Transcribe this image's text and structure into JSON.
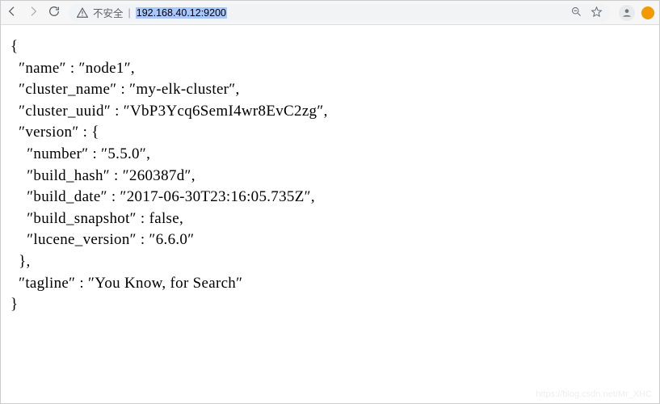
{
  "toolbar": {
    "insecure_label": "不安全",
    "url": "192.168.40.12:9200"
  },
  "response": {
    "name": "node1",
    "cluster_name": "my-elk-cluster",
    "cluster_uuid": "VbP3Ycq6SemI4wr8EvC2zg",
    "version": {
      "number": "5.5.0",
      "build_hash": "260387d",
      "build_date": "2017-06-30T23:16:05.735Z",
      "build_snapshot": "false",
      "lucene_version": "6.6.0"
    },
    "tagline": "You Know, for Search"
  },
  "watermark": "https://blog.csdn.net/Mr_XHC"
}
